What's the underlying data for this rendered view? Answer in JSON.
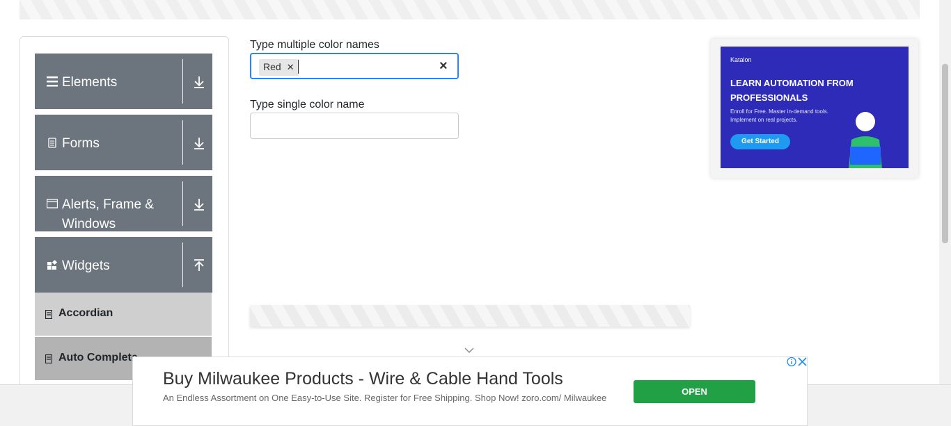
{
  "sidebar": {
    "groups": [
      {
        "label": "Elements"
      },
      {
        "label": "Forms"
      },
      {
        "label": "Alerts, Frame & Windows"
      },
      {
        "label": "Widgets"
      }
    ],
    "subitems": [
      {
        "label": "Accordian"
      },
      {
        "label": "Auto Complete"
      }
    ]
  },
  "main": {
    "multi_label": "Type multiple color names",
    "chip": "Red",
    "single_label": "Type single color name",
    "single_value": ""
  },
  "ad": {
    "brand": "Katalon",
    "headline": "LEARN AUTOMATION FROM PROFESSIONALS",
    "sub": "Enroll for Free. Master in-demand tools. Implement on real projects.",
    "button": "Get Started"
  },
  "bottom_ad": {
    "title": "Buy Milwaukee Products - Wire & Cable Hand Tools",
    "desc": "An Endless Assortment on One Easy-to-Use Site. Register for Free Shipping. Shop Now! zoro.com/ Milwaukee",
    "button": "OPEN"
  },
  "colors": {
    "group_bg": "#6c757d",
    "focus_border": "#2684ff",
    "open_button": "#21a046"
  }
}
